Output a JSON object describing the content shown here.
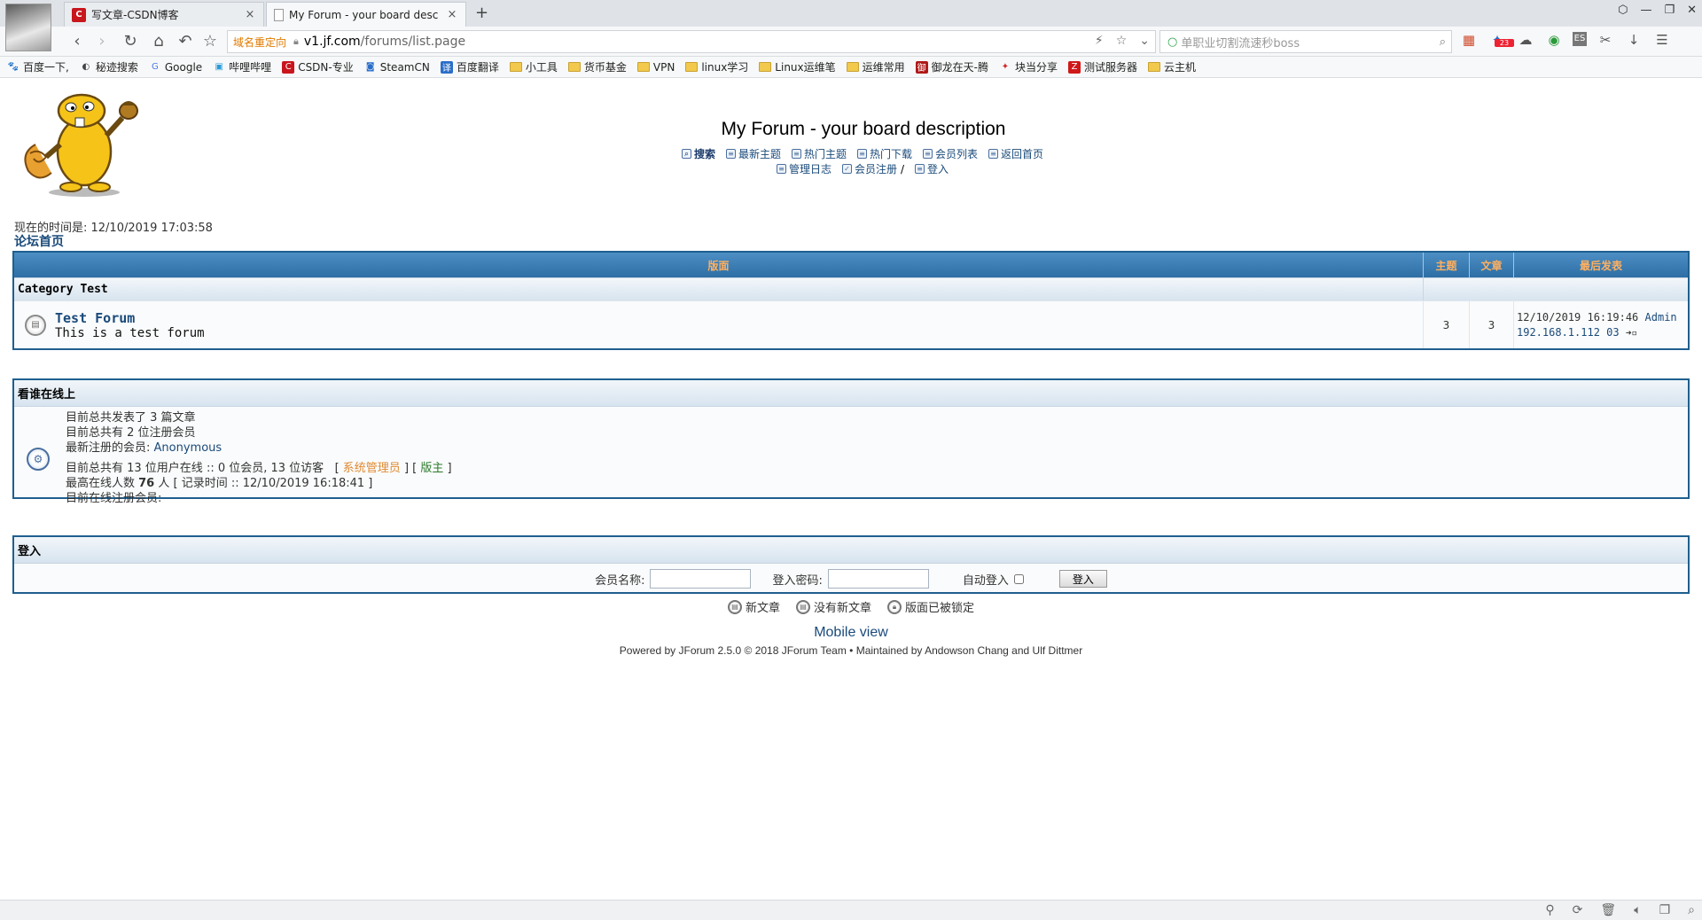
{
  "browser": {
    "tabs": [
      {
        "title": "写文章-CSDN博客",
        "icon": "csdn-icon"
      },
      {
        "title": "My Forum - your board desc",
        "icon": "page-icon"
      }
    ],
    "url_tag": "域名重定向",
    "url_host": "v1.jf.com",
    "url_path": "/forums/list.page",
    "search_placeholder": "单职业切割流速秒boss",
    "ext_badge": "23",
    "bookmarks": [
      {
        "label": "百度一下,",
        "icon": "paw-icon"
      },
      {
        "label": "秘迹搜索",
        "icon": "secret-search-icon"
      },
      {
        "label": "Google",
        "icon": "google-icon"
      },
      {
        "label": "哔哩哔哩",
        "icon": "bilibili-icon"
      },
      {
        "label": "CSDN-专业",
        "icon": "csdn-icon"
      },
      {
        "label": "SteamCN",
        "icon": "steam-icon"
      },
      {
        "label": "百度翻译",
        "icon": "translate-icon"
      },
      {
        "label": "小工具",
        "icon": "folder-icon"
      },
      {
        "label": "货币基金",
        "icon": "folder-icon"
      },
      {
        "label": "VPN",
        "icon": "folder-icon"
      },
      {
        "label": "linux学习",
        "icon": "folder-icon"
      },
      {
        "label": "Linux运维笔",
        "icon": "folder-icon"
      },
      {
        "label": "运维常用",
        "icon": "folder-icon"
      },
      {
        "label": "御龙在天-腾",
        "icon": "game-icon"
      },
      {
        "label": "块当分享",
        "icon": "share-icon"
      },
      {
        "label": "测试服务器",
        "icon": "z-icon"
      },
      {
        "label": "云主机",
        "icon": "folder-icon"
      }
    ]
  },
  "forum": {
    "title": "My Forum - your board description",
    "links_row1": [
      {
        "label": "搜索",
        "icon": "search-icon",
        "bold": true
      },
      {
        "label": "最新主题",
        "icon": "new-topics-icon"
      },
      {
        "label": "热门主题",
        "icon": "hot-topics-icon"
      },
      {
        "label": "热门下载",
        "icon": "hot-downloads-icon"
      },
      {
        "label": "会员列表",
        "icon": "member-list-icon"
      },
      {
        "label": "返回首页",
        "icon": "home-icon"
      }
    ],
    "links_row2": [
      {
        "label": "管理日志",
        "icon": "mod-log-icon"
      },
      {
        "label": "会员注册",
        "icon": "register-icon"
      },
      {
        "label": "登入",
        "icon": "login-icon"
      }
    ],
    "current_time": "现在的时间是: 12/10/2019 17:03:58",
    "breadcrumb": "论坛首页"
  },
  "board_table": {
    "headers": [
      "版面",
      "主题",
      "文章",
      "最后发表"
    ],
    "category": "Category Test",
    "forums": [
      {
        "name": "Test Forum",
        "description": "This is a test forum",
        "topics": "3",
        "posts": "3",
        "last_post_time": "12/10/2019 16:19:46",
        "last_post_user": "Admin",
        "last_post_ip": "192.168.1.112 03"
      }
    ]
  },
  "online": {
    "title": "看谁在线上",
    "total_posts": "目前总共发表了 3 篇文章",
    "total_users": "目前总共有 2 位注册会员",
    "newest_label": "最新注册的会员: ",
    "newest_user": "Anonymous",
    "online_now": "目前总共有 13 位用户在线 :: 0 位会员, 13 位访客",
    "role_admin": "系统管理员",
    "role_mod": "版主",
    "record_prefix": "最高在线人数 ",
    "record_count": "76",
    "record_suffix": " 人 [ 记录时间 :: 12/10/2019 16:18:41 ]",
    "registered_online": "目前在线注册会员:"
  },
  "login": {
    "title": "登入",
    "username_label": "会员名称:",
    "password_label": "登入密码:",
    "autologin_label": "自动登入",
    "button": "登入"
  },
  "legend": [
    {
      "label": "新文章",
      "icon": "new-posts-icon"
    },
    {
      "label": "没有新文章",
      "icon": "no-new-posts-icon"
    },
    {
      "label": "版面已被锁定",
      "icon": "locked-forum-icon"
    }
  ],
  "footer": {
    "mobile": "Mobile view",
    "powered": "Powered by JForum 2.5.0 © 2018 JForum Team • Maintained by Andowson Chang and Ulf Dittmer"
  }
}
